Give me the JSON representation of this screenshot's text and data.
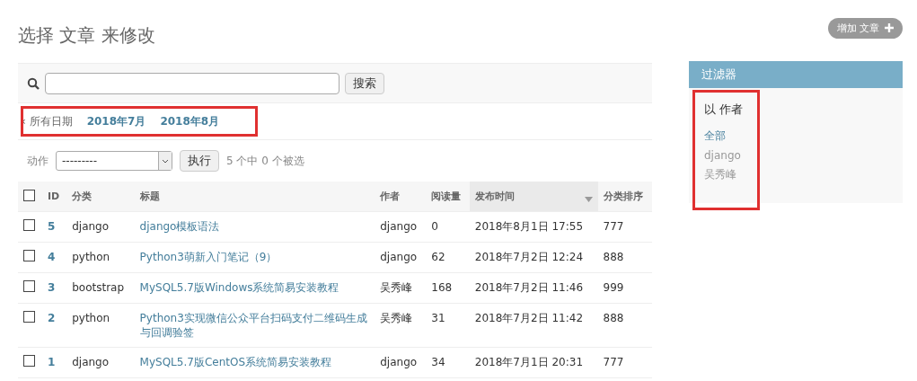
{
  "page_title": "选择 文章 来修改",
  "add_button": {
    "label": "增加 文章"
  },
  "search": {
    "button": "搜索"
  },
  "date_hierarchy": {
    "highlighted": true,
    "back": "‹ 所有日期",
    "items": [
      "2018年7月",
      "2018年8月"
    ]
  },
  "actions": {
    "label": "动作",
    "select_value": "---------",
    "button": "执行",
    "counter": "5 个中 0 个被选"
  },
  "table": {
    "select_all_checked": false,
    "columns": [
      {
        "label": "ID",
        "sorted": false
      },
      {
        "label": "分类",
        "sorted": false
      },
      {
        "label": "标题",
        "sorted": false
      },
      {
        "label": "作者",
        "sorted": false
      },
      {
        "label": "阅读量",
        "sorted": false
      },
      {
        "label": "发布时间",
        "sorted": true
      },
      {
        "label": "分类排序",
        "sorted": false
      }
    ],
    "rows": [
      {
        "checked": false,
        "cells": [
          "5",
          "django",
          "django模板语法",
          "django",
          "0",
          "2018年8月1日 17:55",
          "777"
        ]
      },
      {
        "checked": false,
        "cells": [
          "4",
          "python",
          "Python3萌新入门笔记（9）",
          "django",
          "62",
          "2018年7月2日 12:24",
          "888"
        ]
      },
      {
        "checked": false,
        "cells": [
          "3",
          "bootstrap",
          "MySQL5.7版Windows系统简易安装教程",
          "吴秀峰",
          "168",
          "2018年7月2日 11:46",
          "999"
        ]
      },
      {
        "checked": false,
        "cells": [
          "2",
          "python",
          "Python3实现微信公众平台扫码支付二维码生成与回调验签",
          "吴秀峰",
          "31",
          "2018年7月2日 11:42",
          "888"
        ]
      },
      {
        "checked": false,
        "cells": [
          "1",
          "django",
          "MySQL5.7版CentOS系统简易安装教程",
          "django",
          "34",
          "2018年7月1日 20:31",
          "777"
        ]
      }
    ]
  },
  "filter": {
    "title": "过滤器",
    "highlighted": true,
    "heading": "以 作者",
    "items": [
      {
        "label": "全部",
        "selected": true
      },
      {
        "label": "django",
        "selected": false
      },
      {
        "label": "吴秀峰",
        "selected": false
      }
    ]
  }
}
